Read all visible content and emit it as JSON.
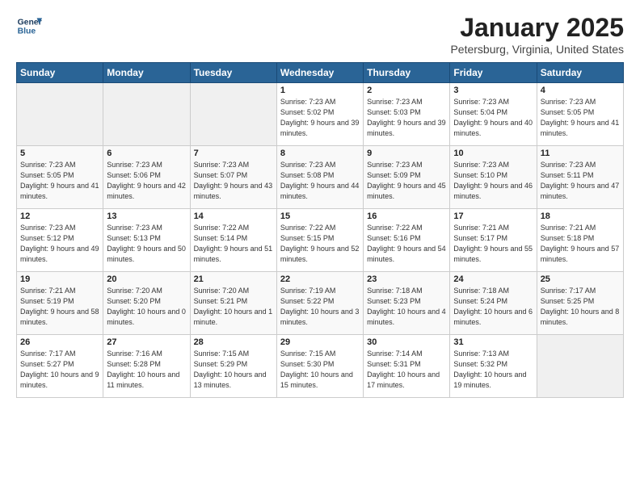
{
  "header": {
    "logo_line1": "General",
    "logo_line2": "Blue",
    "month": "January 2025",
    "location": "Petersburg, Virginia, United States"
  },
  "weekdays": [
    "Sunday",
    "Monday",
    "Tuesday",
    "Wednesday",
    "Thursday",
    "Friday",
    "Saturday"
  ],
  "weeks": [
    [
      {
        "day": "",
        "info": ""
      },
      {
        "day": "",
        "info": ""
      },
      {
        "day": "",
        "info": ""
      },
      {
        "day": "1",
        "info": "Sunrise: 7:23 AM\nSunset: 5:02 PM\nDaylight: 9 hours and 39 minutes."
      },
      {
        "day": "2",
        "info": "Sunrise: 7:23 AM\nSunset: 5:03 PM\nDaylight: 9 hours and 39 minutes."
      },
      {
        "day": "3",
        "info": "Sunrise: 7:23 AM\nSunset: 5:04 PM\nDaylight: 9 hours and 40 minutes."
      },
      {
        "day": "4",
        "info": "Sunrise: 7:23 AM\nSunset: 5:05 PM\nDaylight: 9 hours and 41 minutes."
      }
    ],
    [
      {
        "day": "5",
        "info": "Sunrise: 7:23 AM\nSunset: 5:05 PM\nDaylight: 9 hours and 41 minutes."
      },
      {
        "day": "6",
        "info": "Sunrise: 7:23 AM\nSunset: 5:06 PM\nDaylight: 9 hours and 42 minutes."
      },
      {
        "day": "7",
        "info": "Sunrise: 7:23 AM\nSunset: 5:07 PM\nDaylight: 9 hours and 43 minutes."
      },
      {
        "day": "8",
        "info": "Sunrise: 7:23 AM\nSunset: 5:08 PM\nDaylight: 9 hours and 44 minutes."
      },
      {
        "day": "9",
        "info": "Sunrise: 7:23 AM\nSunset: 5:09 PM\nDaylight: 9 hours and 45 minutes."
      },
      {
        "day": "10",
        "info": "Sunrise: 7:23 AM\nSunset: 5:10 PM\nDaylight: 9 hours and 46 minutes."
      },
      {
        "day": "11",
        "info": "Sunrise: 7:23 AM\nSunset: 5:11 PM\nDaylight: 9 hours and 47 minutes."
      }
    ],
    [
      {
        "day": "12",
        "info": "Sunrise: 7:23 AM\nSunset: 5:12 PM\nDaylight: 9 hours and 49 minutes."
      },
      {
        "day": "13",
        "info": "Sunrise: 7:23 AM\nSunset: 5:13 PM\nDaylight: 9 hours and 50 minutes."
      },
      {
        "day": "14",
        "info": "Sunrise: 7:22 AM\nSunset: 5:14 PM\nDaylight: 9 hours and 51 minutes."
      },
      {
        "day": "15",
        "info": "Sunrise: 7:22 AM\nSunset: 5:15 PM\nDaylight: 9 hours and 52 minutes."
      },
      {
        "day": "16",
        "info": "Sunrise: 7:22 AM\nSunset: 5:16 PM\nDaylight: 9 hours and 54 minutes."
      },
      {
        "day": "17",
        "info": "Sunrise: 7:21 AM\nSunset: 5:17 PM\nDaylight: 9 hours and 55 minutes."
      },
      {
        "day": "18",
        "info": "Sunrise: 7:21 AM\nSunset: 5:18 PM\nDaylight: 9 hours and 57 minutes."
      }
    ],
    [
      {
        "day": "19",
        "info": "Sunrise: 7:21 AM\nSunset: 5:19 PM\nDaylight: 9 hours and 58 minutes."
      },
      {
        "day": "20",
        "info": "Sunrise: 7:20 AM\nSunset: 5:20 PM\nDaylight: 10 hours and 0 minutes."
      },
      {
        "day": "21",
        "info": "Sunrise: 7:20 AM\nSunset: 5:21 PM\nDaylight: 10 hours and 1 minute."
      },
      {
        "day": "22",
        "info": "Sunrise: 7:19 AM\nSunset: 5:22 PM\nDaylight: 10 hours and 3 minutes."
      },
      {
        "day": "23",
        "info": "Sunrise: 7:18 AM\nSunset: 5:23 PM\nDaylight: 10 hours and 4 minutes."
      },
      {
        "day": "24",
        "info": "Sunrise: 7:18 AM\nSunset: 5:24 PM\nDaylight: 10 hours and 6 minutes."
      },
      {
        "day": "25",
        "info": "Sunrise: 7:17 AM\nSunset: 5:25 PM\nDaylight: 10 hours and 8 minutes."
      }
    ],
    [
      {
        "day": "26",
        "info": "Sunrise: 7:17 AM\nSunset: 5:27 PM\nDaylight: 10 hours and 9 minutes."
      },
      {
        "day": "27",
        "info": "Sunrise: 7:16 AM\nSunset: 5:28 PM\nDaylight: 10 hours and 11 minutes."
      },
      {
        "day": "28",
        "info": "Sunrise: 7:15 AM\nSunset: 5:29 PM\nDaylight: 10 hours and 13 minutes."
      },
      {
        "day": "29",
        "info": "Sunrise: 7:15 AM\nSunset: 5:30 PM\nDaylight: 10 hours and 15 minutes."
      },
      {
        "day": "30",
        "info": "Sunrise: 7:14 AM\nSunset: 5:31 PM\nDaylight: 10 hours and 17 minutes."
      },
      {
        "day": "31",
        "info": "Sunrise: 7:13 AM\nSunset: 5:32 PM\nDaylight: 10 hours and 19 minutes."
      },
      {
        "day": "",
        "info": ""
      }
    ]
  ]
}
